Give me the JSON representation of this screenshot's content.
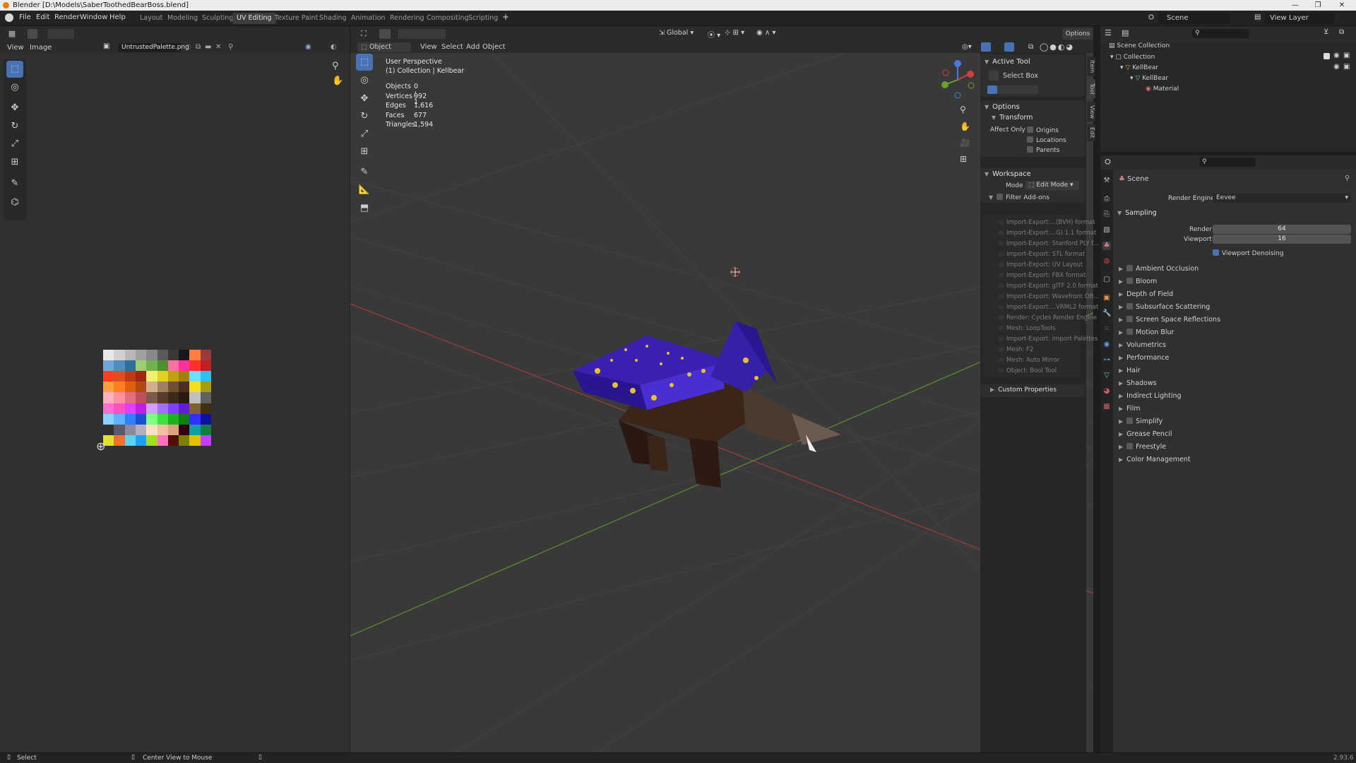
{
  "title_bar": {
    "title": "Blender [D:\\Models\\SaberToothedBearBoss.blend]"
  },
  "menu": [
    "File",
    "Edit",
    "Render",
    "Window",
    "Help"
  ],
  "workspaces": [
    "Layout",
    "Modeling",
    "Sculpting",
    "UV Editing",
    "Texture Paint",
    "Shading",
    "Animation",
    "Rendering",
    "Compositing",
    "Scripting"
  ],
  "active_workspace": "UV Editing",
  "scene": {
    "name": "Scene",
    "view_layer": "View Layer"
  },
  "uv_editor": {
    "menus": [
      "View",
      "Image"
    ],
    "image_name": "UntrustedPalette.png"
  },
  "viewport": {
    "mode": "Object Mode",
    "menus": [
      "View",
      "Select",
      "Add",
      "Object"
    ],
    "transform_orientation": "Global",
    "options_label": "Options",
    "perspective": "User Perspective",
    "collection_label": "(1) Collection | Kellbear",
    "stats": [
      {
        "k": "Objects",
        "v": "0 / 1"
      },
      {
        "k": "Vertices",
        "v": "992"
      },
      {
        "k": "Edges",
        "v": "1,616"
      },
      {
        "k": "Faces",
        "v": "677"
      },
      {
        "k": "Triangles",
        "v": "1,594"
      }
    ]
  },
  "npanel": {
    "active_tool": "Active Tool",
    "tool_name": "Select Box",
    "options": "Options",
    "transform": "Transform",
    "affect_only": "Affect Only",
    "affect": [
      "Origins",
      "Locations",
      "Parents"
    ],
    "workspace": "Workspace",
    "mode_label": "Mode",
    "mode_value": "Edit Mode",
    "filter_addons": "Filter Add-ons",
    "addons": [
      "Import-Export:...(BVH) format",
      "Import-Export:...G) 1.1 format",
      "Import-Export: Stanford PLY f...",
      "Import-Export: STL format",
      "Import-Export: UV Layout",
      "Import-Export: FBX format",
      "Import-Export: glTF 2.0 format",
      "Import-Export: Wavefront OB...",
      "Import-Export:...VRML2 format",
      "Render: Cycles Render Engine",
      "Mesh: LoopTools",
      "Import-Export: Import Palettes",
      "Mesh: F2",
      "Mesh: Auto Mirror",
      "Object: Bool Tool"
    ],
    "custom_properties": "Custom Properties",
    "tabs": [
      "Item",
      "Tool",
      "View",
      "Edit"
    ]
  },
  "outliner": {
    "items": [
      "Scene Collection",
      "Collection",
      "KellBear",
      "KellBear",
      "Material"
    ]
  },
  "properties": {
    "scene": "Scene",
    "render_engine_label": "Render Engine",
    "render_engine": "Eevee",
    "sampling": "Sampling",
    "render_label": "Render",
    "render_value": "64",
    "viewport_label": "Viewport",
    "viewport_value": "16",
    "denoise": "Viewport Denoising",
    "sections": [
      "Ambient Occlusion",
      "Bloom",
      "Depth of Field",
      "Subsurface Scattering",
      "Screen Space Reflections",
      "Motion Blur",
      "Volumetrics",
      "Performance",
      "Hair",
      "Shadows",
      "Indirect Lighting",
      "Film",
      "Simplify",
      "Grease Pencil",
      "Freestyle",
      "Color Management"
    ],
    "checkbox_sections": [
      "Ambient Occlusion",
      "Bloom",
      "Subsurface Scattering",
      "Screen Space Reflections",
      "Motion Blur",
      "Simplify",
      "Freestyle"
    ]
  },
  "status_bar": {
    "select": "Select",
    "center": "Center View to Mouse",
    "version": "2.93.6"
  },
  "palette_colors": [
    "#e8e8e8",
    "#d0d0d0",
    "#b8b8b8",
    "#a0a0a0",
    "#888",
    "#5a5a5a",
    "#383838",
    "#181818",
    "#ff7f3f",
    "#9a3a3a",
    "#6fa8d8",
    "#4f8cc0",
    "#2f6fa0",
    "#9ad06f",
    "#6fb04f",
    "#4f8f2f",
    "#ff6fa0",
    "#ff2f9f",
    "#ff2f2f",
    "#c02020",
    "#ff3f1f",
    "#e0501f",
    "#c03a1a",
    "#a02810",
    "#f0f06f",
    "#e0d020",
    "#c0a010",
    "#a08010",
    "#6fdfff",
    "#2fbfef",
    "#ff9f3f",
    "#ff7f1f",
    "#e06010",
    "#b04a10",
    "#d0b090",
    "#a08060",
    "#705030",
    "#4a3020",
    "#f0e020",
    "#a0a010",
    "#ffb0c0",
    "#ff90a0",
    "#e07080",
    "#c05060",
    "#7a5a4a",
    "#5a3a2a",
    "#3a2a1a",
    "#2a1a10",
    "#c0c0c0",
    "#606060",
    "#ff6fd0",
    "#ff4fc0",
    "#e03fff",
    "#c020e0",
    "#d0a0ff",
    "#a070ff",
    "#8040ff",
    "#6020d0",
    "#806030",
    "#403010",
    "#8fd0ff",
    "#5fb0ff",
    "#2f7fff",
    "#1f4fd0",
    "#80ff80",
    "#40e040",
    "#20b020",
    "#108010",
    "#3030ff",
    "#1010a0",
    "#303030",
    "#5a5a6a",
    "#8a8a9a",
    "#b0b0c0",
    "#ffe0c0",
    "#f0c0a0",
    "#e0a080",
    "#300010",
    "#10a0a0",
    "#108040",
    "#e0e030",
    "#f07030",
    "#60d0f0",
    "#20a0f0",
    "#a0e020",
    "#ff70c0",
    "#501000",
    "#808000",
    "#e0c000",
    "#c040ff"
  ]
}
